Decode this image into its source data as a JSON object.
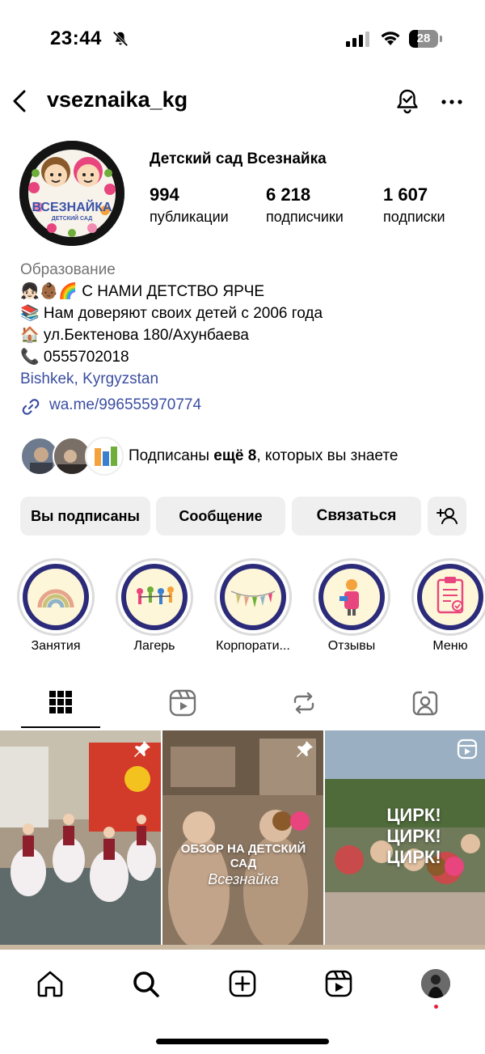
{
  "status_bar": {
    "time": "23:44",
    "battery": "28"
  },
  "header": {
    "username": "vseznaika_kg"
  },
  "profile": {
    "name": "Детский сад Всезнайка",
    "avatar_text": "ВСЕЗНАЙКА",
    "avatar_subtext": "ДЕТСКИЙ САД",
    "stats": [
      {
        "value": "994",
        "label": "публикации"
      },
      {
        "value": "6 218",
        "label": "подписчики"
      },
      {
        "value": "1 607",
        "label": "подписки"
      }
    ]
  },
  "bio": {
    "category": "Образование",
    "lines": [
      "👧🏻👶🏾🌈 С НАМИ ДЕТСТВО ЯРЧЕ",
      "📚 Нам доверяют своих детей с 2006 года",
      "🏠 ул.Бектенова 180/Ахунбаева",
      "📞 0555702018"
    ],
    "location": "Bishkek, Kyrgyzstan",
    "link": "wa.me/996555970774"
  },
  "followed_by": {
    "prefix": "Подписаны ",
    "bold": "ещё 8",
    "suffix": ", которых вы знаете"
  },
  "actions": {
    "following": "Вы подписаны",
    "message": "Сообщение",
    "contact": "Связаться"
  },
  "highlights": [
    {
      "label": "Занятия"
    },
    {
      "label": "Лагерь"
    },
    {
      "label": "Корпорати..."
    },
    {
      "label": "Отзывы"
    },
    {
      "label": "Меню"
    }
  ],
  "posts": [
    {
      "caption": ""
    },
    {
      "caption": "ОБЗОР НА ДЕТСКИЙ САД",
      "caption2": "Всезнайка"
    },
    {
      "caption": "ЦИРК! ЦИРК! ЦИРК!"
    }
  ],
  "colors": {
    "link": "#3b4ea2",
    "button_bg": "#efefef",
    "highlight_ring": "#2b2b7a",
    "notification_dot": "#ed1c3a"
  }
}
